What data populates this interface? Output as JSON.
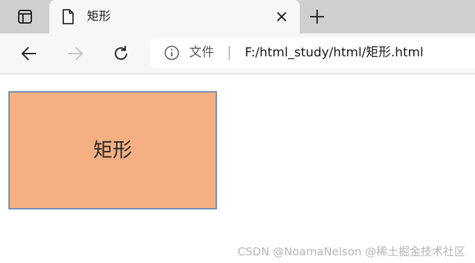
{
  "tab": {
    "title": "矩形"
  },
  "address": {
    "site_label": "文件",
    "url": "F:/html_study/html/矩形.html"
  },
  "page": {
    "rect_label": "矩形"
  },
  "watermark": {
    "text": "CSDN @NoamaNelson @稀土掘金技术社区"
  },
  "colors": {
    "rect_fill": "#f4b083",
    "rect_border": "#6e8fb1",
    "tabstrip": "#cfcfcf",
    "toolbar": "#f7f7f7"
  },
  "icons": {
    "tab_actions": "tab-actions-icon",
    "page": "page-icon",
    "close": "close-icon",
    "new_tab": "plus-icon",
    "back": "back-arrow-icon",
    "forward": "forward-arrow-icon",
    "refresh": "refresh-icon",
    "info": "info-icon"
  }
}
